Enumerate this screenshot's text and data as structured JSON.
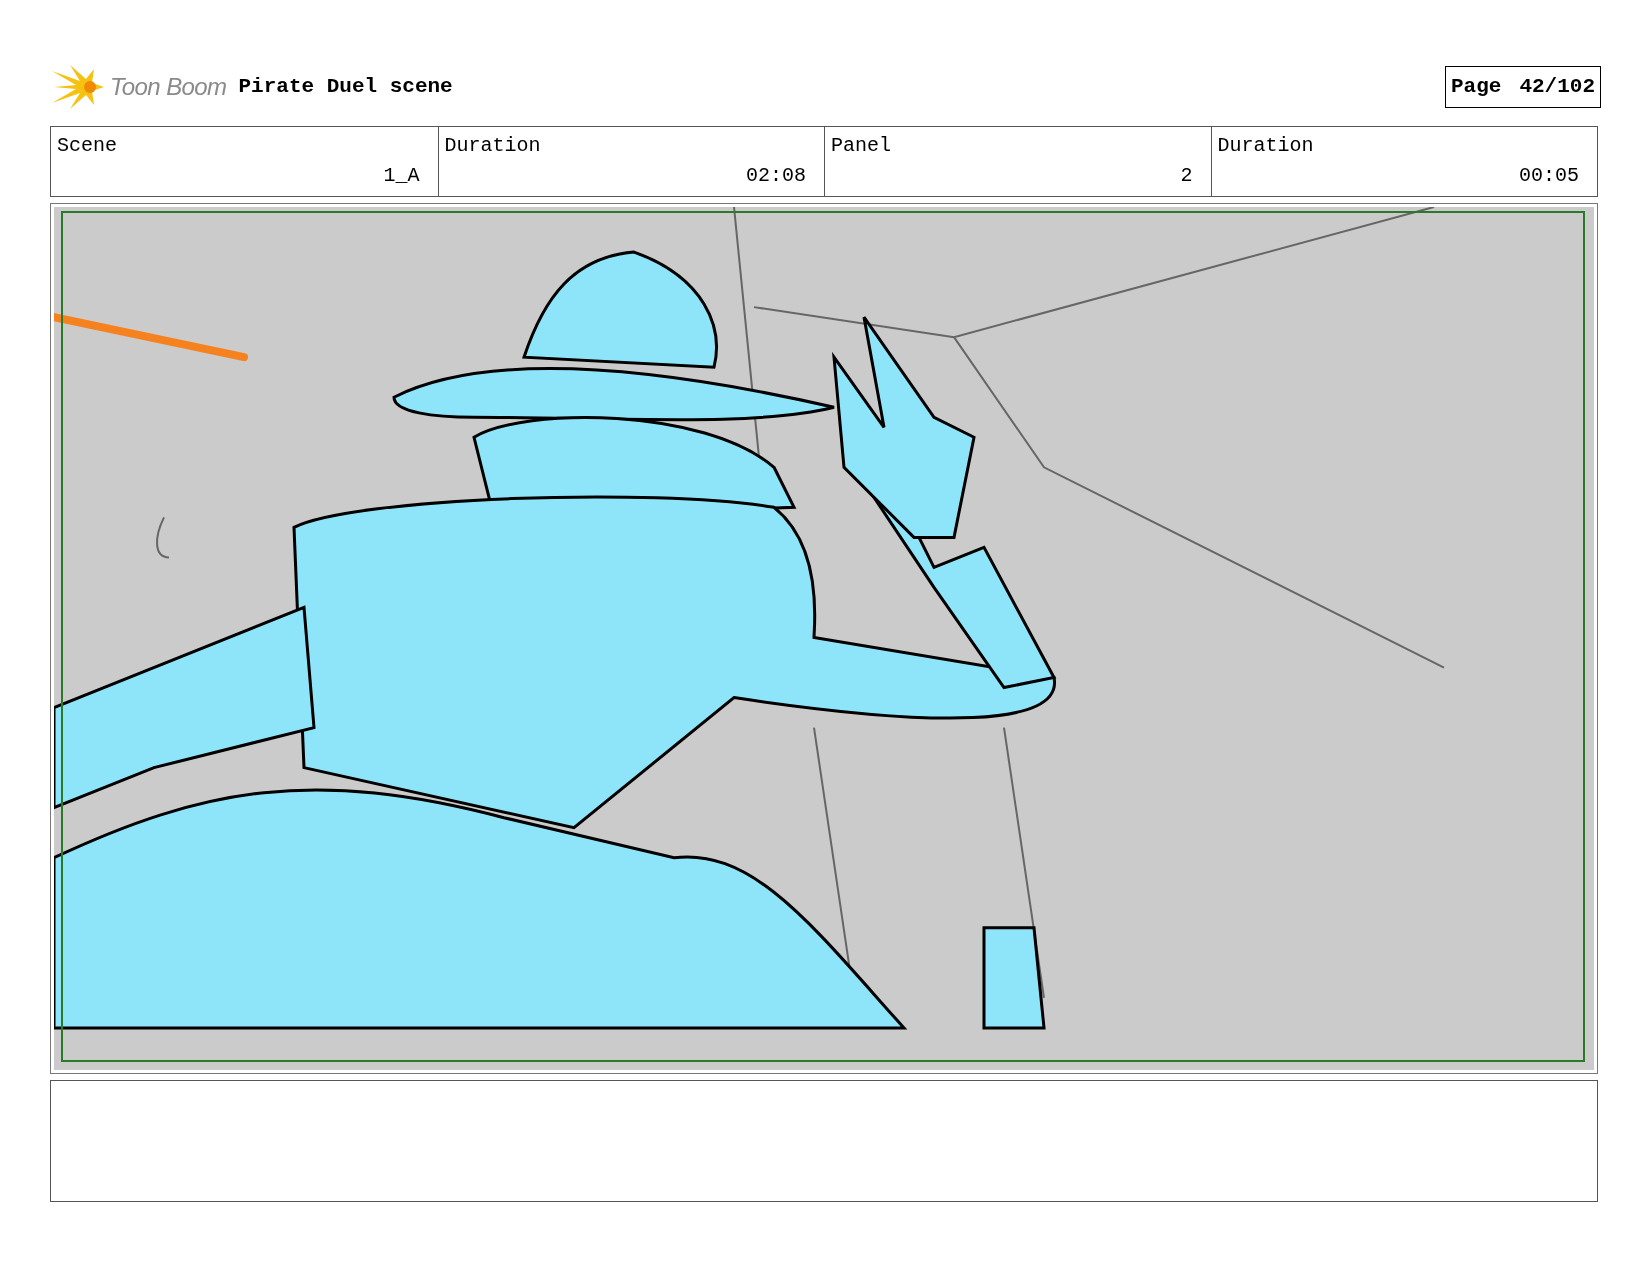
{
  "header": {
    "logo": "Toon Boom",
    "title": "Pirate Duel scene",
    "page_label": "Page",
    "page_number": "42/102"
  },
  "info": [
    {
      "label": "Scene",
      "value": "1_A"
    },
    {
      "label": "Duration",
      "value": "02:08"
    },
    {
      "label": "Panel",
      "value": "2"
    },
    {
      "label": "Duration",
      "value": "00:05"
    }
  ]
}
